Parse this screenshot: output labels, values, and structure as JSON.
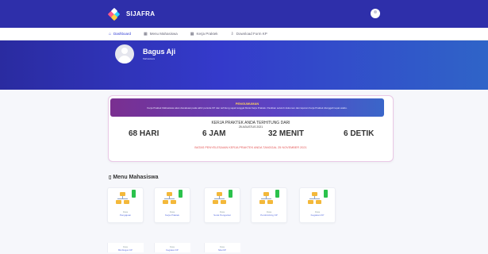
{
  "app": {
    "brand": "SIJAFRA"
  },
  "nav": {
    "items": [
      {
        "label": "Dashboard",
        "icon": "home-icon"
      },
      {
        "label": "Menu Mahasiswa",
        "icon": "grid-icon"
      },
      {
        "label": "Kerja Praktek",
        "icon": "grid-icon"
      },
      {
        "label": "Download Form KP",
        "icon": "download-icon"
      }
    ]
  },
  "profile": {
    "name": "Bagus Aji",
    "subtitle": "Mahasiswa"
  },
  "announcement": {
    "title": "PENGUMUMAN",
    "text": "Kerja Praktek Mahasiswa akan dievaluasi pada akhir periode KP dan terhitung sejak tanggal Mulai Kerja Praktek. Pastikan seluruh dokumen dan laporan Kerja Praktek diunggah tepat waktu."
  },
  "countdown": {
    "title": "KERJA PRAKTEK ANDA TERHITUNG DARI",
    "date": "25 AGUSTUS 2021",
    "days": "68 HARI",
    "hours": "6 JAM",
    "minutes": "32 MENIT",
    "seconds": "6 DETIK",
    "deadline": "BATAS PENYELESAIAN KERJA PRAKTEK ANDA TANGGAL 25 NOVEMBER 2021"
  },
  "menu": {
    "title": "Menu Mahasiswa",
    "tiles": [
      {
        "label1": "Data",
        "label2": "Pengajuan"
      },
      {
        "label1": "Data",
        "label2": "Kerja Praktek"
      },
      {
        "label1": "Data",
        "label2": "Surat Pengantar"
      },
      {
        "label1": "Data",
        "label2": "Pembimbing KP"
      },
      {
        "label1": "Data",
        "label2": "Kegiatan KP"
      }
    ],
    "small_tiles": [
      {
        "label1": "Data",
        "label2": "Bimbingan KP"
      },
      {
        "label1": "Data",
        "label2": "Kegiatan KP"
      },
      {
        "label1": "Data",
        "label2": "Nilai KP"
      }
    ]
  },
  "colors": {
    "topbar": "#2e2faa",
    "accent": "#2f3bd3",
    "deadline": "#e45656",
    "tile_bar": "#2bc24c",
    "tile_node": "#f3b83a"
  }
}
